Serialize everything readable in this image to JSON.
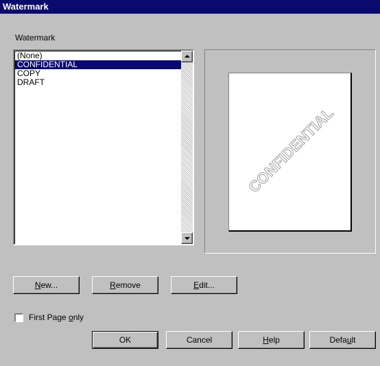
{
  "window": {
    "title": "Watermark"
  },
  "group_label": "Watermark",
  "list": {
    "items": [
      "(None)",
      "CONFIDENTIAL",
      "COPY",
      "DRAFT"
    ],
    "selected_index": 1
  },
  "preview": {
    "watermark_text": "CONFIDENTIAL"
  },
  "buttons": {
    "new": {
      "pre": "",
      "key": "N",
      "post": "ew..."
    },
    "remove": {
      "pre": "",
      "key": "R",
      "post": "emove"
    },
    "edit": {
      "pre": "",
      "key": "E",
      "post": "dit..."
    },
    "ok": "OK",
    "cancel": "Cancel",
    "help": {
      "pre": "",
      "key": "H",
      "post": "elp"
    },
    "default": {
      "pre": "Defa",
      "key": "u",
      "post": "lt"
    }
  },
  "first_page_only": {
    "label_pre": "First Page ",
    "label_key": "o",
    "label_post": "nly",
    "checked": false
  },
  "colors": {
    "selection": "#0a0a6e",
    "face": "#c0c0c0",
    "watermark": "#a0a0a0"
  }
}
